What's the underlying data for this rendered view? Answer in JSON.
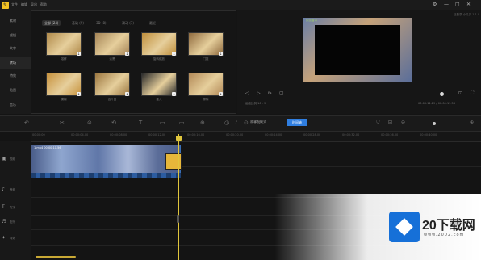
{
  "titlebar": {
    "logo": "✎",
    "menus": [
      "文件",
      "编辑",
      "导出",
      "帮助"
    ],
    "window_buttons": [
      "⚙",
      "—",
      "□",
      "✕"
    ],
    "info": "已登录 小贝贝 1.1.0"
  },
  "leftnav": {
    "items": [
      {
        "label": "素材",
        "active": false
      },
      {
        "label": "滤镜",
        "active": false
      },
      {
        "label": "文字",
        "active": false
      },
      {
        "label": "转场",
        "active": true
      },
      {
        "label": "特效",
        "active": false
      },
      {
        "label": "贴图",
        "active": false
      },
      {
        "label": "音乐",
        "active": false
      }
    ]
  },
  "media": {
    "tabs": [
      {
        "label": "全部 (24)",
        "active": true
      },
      {
        "label": "基础 (9)",
        "active": false
      },
      {
        "label": "3D (8)",
        "active": false
      },
      {
        "label": "滑动 (7)",
        "active": false
      },
      {
        "label": "最近",
        "active": false
      }
    ],
    "thumbs": [
      {
        "label": "溶解",
        "color": "#b08a4a"
      },
      {
        "label": "淡黑",
        "color": "#a58456"
      },
      {
        "label": "旋转缩放",
        "color": "#c08f3c"
      },
      {
        "label": "门推",
        "color": "#8f6a3e"
      },
      {
        "label": "模糊",
        "color": "#c7923d"
      },
      {
        "label": "百叶窗",
        "color": "#9c7740"
      },
      {
        "label": "推入",
        "color": "#2a2a2a"
      },
      {
        "label": "擦除",
        "color": "#b38a58"
      }
    ]
  },
  "preview": {
    "badge": "预览窗口",
    "ratio_label": "画面比例 16 : 9",
    "timecode": "00:00:11.29 / 00:00:11.56",
    "controls": [
      "◁",
      "▷",
      "⊳",
      "▢"
    ],
    "progress": 0.98
  },
  "toolbar": {
    "tools": [
      "↶",
      "✂",
      "⊘",
      "⟲",
      "T",
      "▭",
      "▭",
      "⊕",
      "◷",
      "♪",
      "⊙",
      "☐"
    ],
    "mode_storyboard": "故事板模式",
    "mode_timeline": "时间轴",
    "zoom_icons": [
      "⊖",
      "⊕"
    ]
  },
  "timeline": {
    "ruler": [
      "00:00:00",
      "00:00:04.00",
      "00:00:08.00",
      "00:00:12.00",
      "00:00:16.00",
      "00:00:20.00",
      "00:00:24.00",
      "00:00:28.00",
      "00:00:32.00",
      "00:00:36.00",
      "00:00:40.00"
    ],
    "tracks": [
      {
        "icon": "▣",
        "name": "视频"
      },
      {
        "icon": "♪",
        "name": "音频"
      },
      {
        "icon": "T",
        "name": "文字"
      },
      {
        "icon": "♬",
        "name": "配乐"
      },
      {
        "icon": "✦",
        "name": "特效"
      }
    ],
    "clip_label": "1.mp4  00:00:11.56"
  },
  "watermark": {
    "text": "20下载网",
    "sub": "www.2002.com"
  }
}
